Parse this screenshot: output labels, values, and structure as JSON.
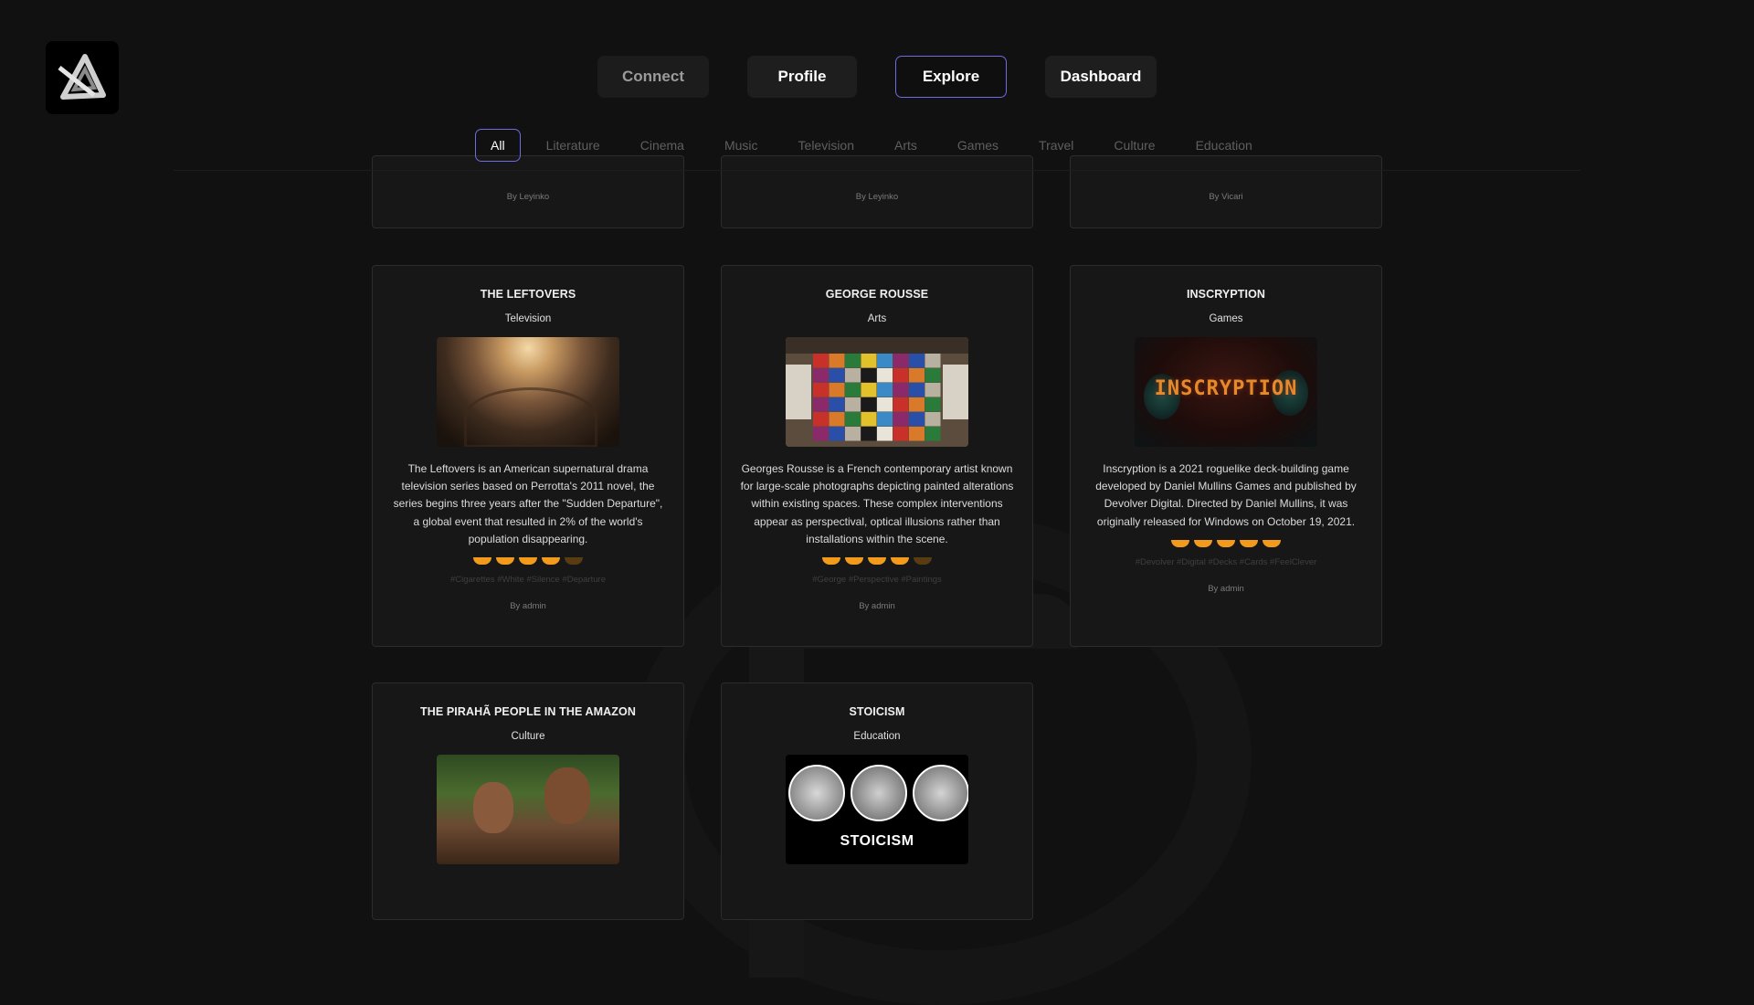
{
  "nav": {
    "connect": "Connect",
    "profile": "Profile",
    "explore": "Explore",
    "dashboard": "Dashboard",
    "active": "Explore",
    "accent_color": "#6b6de0"
  },
  "categories": [
    "All",
    "Literature",
    "Cinema",
    "Music",
    "Television",
    "Arts",
    "Games",
    "Travel",
    "Culture",
    "Education"
  ],
  "active_category": "All",
  "partial_cards": [
    {
      "author": "By Leyinko"
    },
    {
      "author": "By Leyinko"
    },
    {
      "author": "By Vicari"
    }
  ],
  "cards": [
    {
      "title": "THE LEFTOVERS",
      "category": "Television",
      "image": "church-dome-fresco",
      "description": "The Leftovers is an American supernatural drama television series based on Perrotta's 2011 novel, the series begins three years after the \"Sudden Departure\", a global event that resulted in 2% of the world's population disappearing.",
      "rating": 4,
      "tags": "#Cigarettes #White #Silence #Departure",
      "author": "By admin"
    },
    {
      "title": "GEORGE ROUSSE",
      "category": "Arts",
      "image": "colorful-grid-room",
      "description": "Georges Rousse is a French contemporary artist known for large-scale photographs depicting painted alterations within existing spaces. These complex interventions appear as perspectival, optical illusions rather than installations within the scene.",
      "rating": 4,
      "tags": "#George #Perspective #Paintings",
      "author": "By admin"
    },
    {
      "title": "INSCRYPTION",
      "category": "Games",
      "image": "inscryption-logo",
      "image_text": "INSCRYPTION",
      "description": "Inscryption is a 2021 roguelike deck-building game developed by Daniel Mullins Games and published by Devolver Digital. Directed by Daniel Mullins, it was originally released for Windows on October 19, 2021.",
      "rating": 5,
      "tags": "#Devolver #Digital #Decks #Cards #FeelClever",
      "author": "By admin"
    },
    {
      "title": "THE PIRAHÃ PEOPLE IN THE AMAZON",
      "category": "Culture",
      "image": "amazon-children-photo"
    },
    {
      "title": "STOICISM",
      "category": "Education",
      "image": "stoic-busts",
      "image_text": "STOICISM"
    }
  ],
  "star_color": "#f29a1c"
}
